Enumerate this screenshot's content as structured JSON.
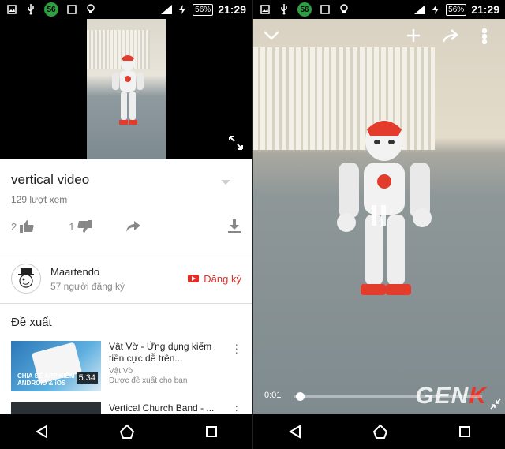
{
  "left": {
    "status": {
      "battery": "56%",
      "time": "21:29",
      "badge": "56"
    },
    "video": {
      "title": "vertical video",
      "views": "129 lượt xem",
      "likes": "2",
      "dislikes": "1"
    },
    "channel": {
      "name": "Maartendo",
      "subscribers": "57 người đăng ký",
      "subscribe_label": "Đăng ký"
    },
    "recommended": {
      "heading": "Đề xuất",
      "items": [
        {
          "title": "Vật Vờ - Ứng dụng kiếm tiền cực dễ trên...",
          "channel": "Vật Vờ",
          "reason": "Được đề xuất cho bạn",
          "duration": "5:34",
          "thumb_text": "CHIA SẺ APP KIẾM ANDROID & iOS"
        },
        {
          "title": "Vertical Church Band - ...",
          "channel": "",
          "reason": "",
          "duration": ""
        }
      ]
    }
  },
  "right": {
    "status": {
      "battery": "56%",
      "time": "21:29",
      "badge": "56"
    },
    "player": {
      "current_time": "0:01",
      "progress_fraction": 0.03
    },
    "watermark": {
      "main": "GEN",
      "accent": "K"
    }
  },
  "colors": {
    "accent_red": "#e52d27",
    "status_green": "#2ea043"
  }
}
